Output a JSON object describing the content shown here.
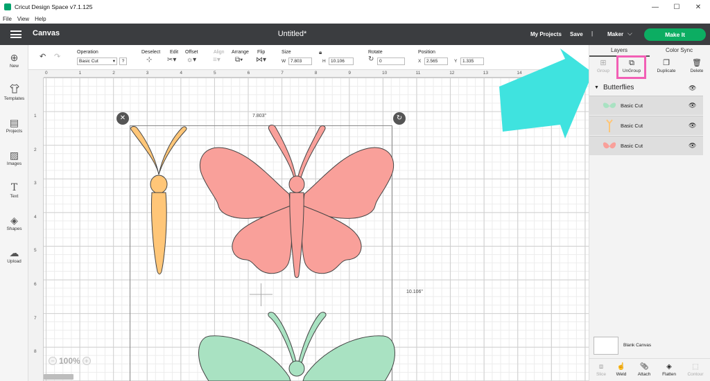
{
  "window": {
    "title": "Cricut Design Space  v7.1.125",
    "minimize": "—",
    "maximize": "☐",
    "close": "✕"
  },
  "menu": [
    "File",
    "View",
    "Help"
  ],
  "header": {
    "section": "Canvas",
    "project_title": "Untitled*",
    "my_projects": "My Projects",
    "save": "Save",
    "separator": "|",
    "machine": "Maker",
    "machine_chevron": "⌵",
    "make_it": "Make It",
    "make_it_color": "#0cad62"
  },
  "toolbar": {
    "operation_label": "Operation",
    "operation_value": "Basic Cut",
    "operation_help": "?",
    "deselect": "Deselect",
    "edit": "Edit",
    "offset": "Offset",
    "align": "Align",
    "arrange": "Arrange",
    "flip": "Flip",
    "size": "Size",
    "w_label": "W",
    "w_value": "7.803",
    "h_label": "H",
    "h_value": "10.106",
    "rotate": "Rotate",
    "rotate_value": "0",
    "position": "Position",
    "x_label": "X",
    "x_value": "2.565",
    "y_label": "Y",
    "y_value": "1.335"
  },
  "leftbar": [
    {
      "label": "New",
      "icon": "plus-circle-icon",
      "glyph": "⊕"
    },
    {
      "label": "Templates",
      "icon": "tshirt-icon",
      "glyph": "👕"
    },
    {
      "label": "Projects",
      "icon": "notebook-icon",
      "glyph": "▤"
    },
    {
      "label": "Images",
      "icon": "image-icon",
      "glyph": "▨"
    },
    {
      "label": "Text",
      "icon": "text-icon",
      "glyph": "T"
    },
    {
      "label": "Shapes",
      "icon": "shapes-icon",
      "glyph": "◈"
    },
    {
      "label": "Upload",
      "icon": "cloud-upload-icon",
      "glyph": "☁"
    }
  ],
  "ruler": {
    "top": [
      "0",
      "1",
      "2",
      "3",
      "4",
      "5",
      "6",
      "7",
      "8",
      "9",
      "10",
      "11",
      "12",
      "13",
      "14"
    ],
    "left": [
      "1",
      "2",
      "3",
      "4",
      "5",
      "6",
      "7",
      "8"
    ]
  },
  "selection": {
    "width_label": "7.803\"",
    "height_label": "10.106\""
  },
  "colors": {
    "orange": "#ffc678",
    "pink": "#f9a09a",
    "green": "#a9e2c2",
    "stroke": "#444444",
    "arrow": "#3fe3df",
    "highlight": "#f25fb5"
  },
  "rightpanel": {
    "tabs": [
      "Layers",
      "Color Sync"
    ],
    "actions": [
      "Group",
      "UnGroup",
      "Duplicate",
      "Delete"
    ],
    "group_name": "Butterflies",
    "layers": [
      {
        "name": "Basic Cut",
        "thumb": "green-butterfly"
      },
      {
        "name": "Basic Cut",
        "thumb": "orange-body"
      },
      {
        "name": "Basic Cut",
        "thumb": "pink-butterfly"
      }
    ],
    "blank_canvas": "Blank Canvas",
    "bottom_tools": [
      "Slice",
      "Weld",
      "Attach",
      "Flatten",
      "Contour"
    ]
  },
  "zoom": {
    "value": "100%",
    "minus": "−",
    "plus": "+"
  }
}
